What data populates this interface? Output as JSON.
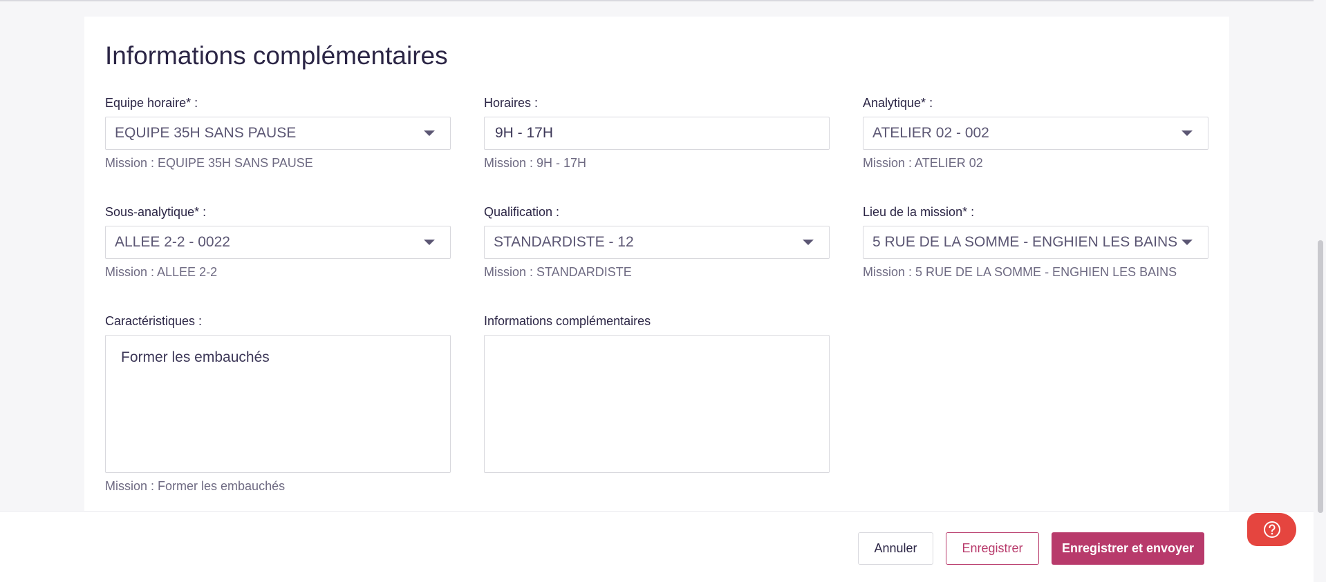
{
  "section": {
    "title": "Informations complémentaires"
  },
  "fields": {
    "equipe": {
      "label": "Equipe horaire* :",
      "value": "EQUIPE 35H SANS PAUSE",
      "hint": "Mission : EQUIPE 35H SANS PAUSE"
    },
    "horaires": {
      "label": "Horaires :",
      "value": "9H - 17H",
      "hint": "Mission : 9H - 17H"
    },
    "analytique": {
      "label": "Analytique* :",
      "value": "ATELIER 02 - 002",
      "hint": "Mission : ATELIER 02"
    },
    "sous_analytique": {
      "label": "Sous-analytique* :",
      "value": "ALLEE 2-2 - 0022",
      "hint": "Mission : ALLEE 2-2"
    },
    "qualification": {
      "label": "Qualification :",
      "value": "STANDARDISTE - 12",
      "hint": "Mission : STANDARDISTE"
    },
    "lieu": {
      "label": "Lieu de la mission* :",
      "value": "5 RUE DE LA SOMME - ENGHIEN LES BAINS",
      "hint": "Mission : 5 RUE DE LA SOMME - ENGHIEN LES BAINS"
    },
    "caracteristiques": {
      "label": "Caractéristiques :",
      "value": "Former les embauchés",
      "hint": "Mission : Former les embauchés"
    },
    "infos": {
      "label": "Informations complémentaires",
      "value": ""
    }
  },
  "footer": {
    "cancel_label": "Annuler",
    "save_label": "Enregistrer",
    "send_label": "Enregistrer et envoyer"
  },
  "icons": {
    "help": "help-circle-icon",
    "dropdown": "chevron-down-icon"
  },
  "colors": {
    "primary": "#b83a6b",
    "help": "#e5453f",
    "text": "#2b2545"
  }
}
